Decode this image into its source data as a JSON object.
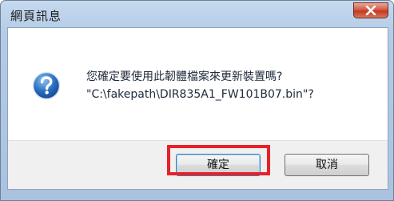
{
  "window": {
    "title": "網頁訊息"
  },
  "icons": {
    "close": "close-icon",
    "question": "question-icon"
  },
  "message": {
    "line1": "您確定要使用此韌體檔案來更新裝置嗎?",
    "line2": "\"C:\\fakepath\\DIR835A1_FW101B07.bin\"?"
  },
  "buttons": {
    "ok_label": "確定",
    "cancel_label": "取消"
  },
  "colors": {
    "highlight": "#e8202a",
    "close_button": "#c0391f",
    "titlebar": "#b3cbe6"
  }
}
